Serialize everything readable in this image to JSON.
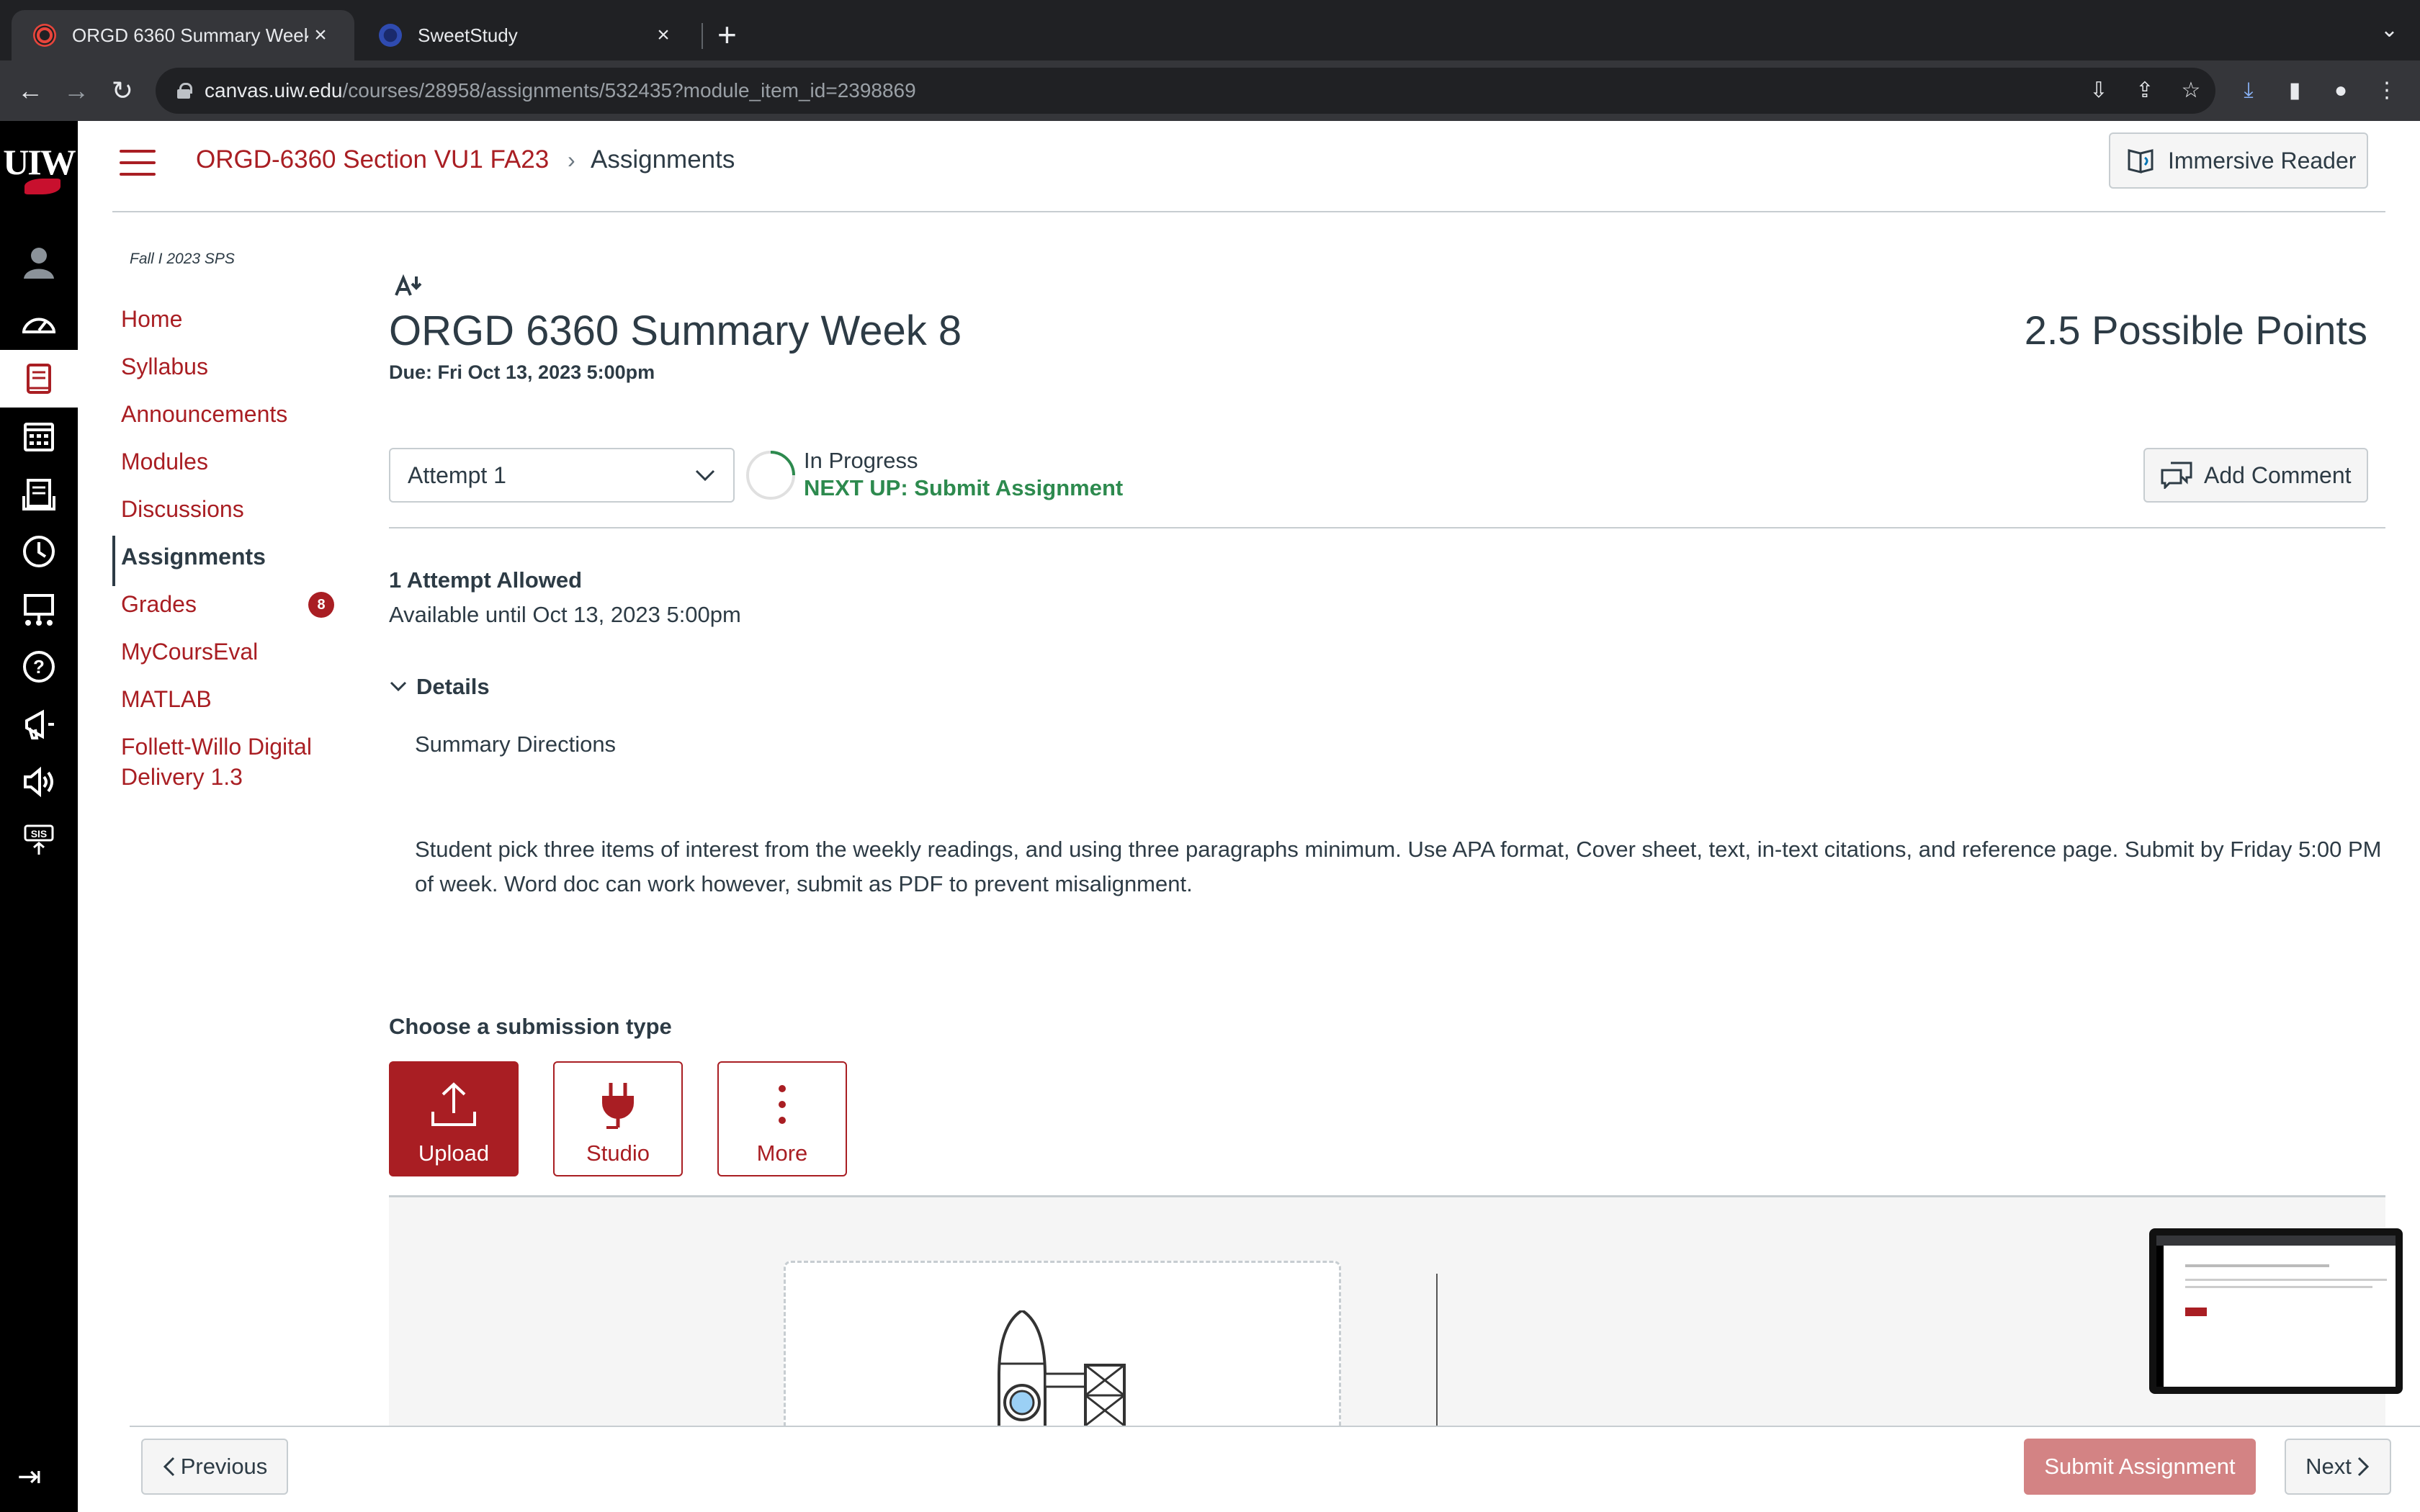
{
  "browser": {
    "tabs": [
      {
        "title": "ORGD 6360 Summary Week 8",
        "active": true
      },
      {
        "title": "SweetStudy",
        "active": false
      }
    ],
    "url_host": "canvas.uiw.edu",
    "url_path": "/courses/28958/assignments/532435?module_item_id=2398869"
  },
  "global_nav": {
    "logo": "UIW",
    "items": [
      "account-icon",
      "dashboard-icon",
      "courses-icon",
      "calendar-icon",
      "inbox-icon",
      "history-icon",
      "commons-icon",
      "help-icon",
      "announcements-icon",
      "accessibility-icon",
      "sis-icon"
    ],
    "sis_label": "SIS"
  },
  "header": {
    "course": "ORGD-6360 Section VU1 FA23",
    "separator": "›",
    "page": "Assignments",
    "immersive_reader": "Immersive Reader"
  },
  "course_nav": {
    "term": "Fall I 2023 SPS",
    "items": [
      {
        "label": "Home"
      },
      {
        "label": "Syllabus"
      },
      {
        "label": "Announcements"
      },
      {
        "label": "Modules"
      },
      {
        "label": "Discussions"
      },
      {
        "label": "Assignments",
        "active": true
      },
      {
        "label": "Grades",
        "badge": "8"
      },
      {
        "label": "MyCoursEval"
      },
      {
        "label": "MATLAB"
      },
      {
        "label": "Follett-Willo Digital Delivery 1.3"
      }
    ]
  },
  "assignment": {
    "title": "ORGD 6360 Summary Week 8",
    "due": "Due: Fri Oct 13, 2023 5:00pm",
    "points": "2.5 Possible Points",
    "attempt_selected": "Attempt 1",
    "status": "In Progress",
    "next_up": "NEXT UP: Submit Assignment",
    "add_comment": "Add Comment",
    "attempts_allowed": "1 Attempt Allowed",
    "available_until": "Available until Oct 13, 2023 5:00pm",
    "details_label": "Details",
    "description_heading": "Summary Directions",
    "description_body": "Student pick three items of interest from the weekly readings, and using three paragraphs minimum. Use APA format, Cover sheet, text, in-text citations, and reference page. Submit by Friday  5:00 PM of week. Word doc can work however, submit as PDF to prevent misalignment."
  },
  "submission": {
    "heading": "Choose a submission type",
    "types": [
      {
        "label": "Upload",
        "icon": "upload-icon",
        "selected": true
      },
      {
        "label": "Studio",
        "icon": "plug-icon",
        "selected": false
      },
      {
        "label": "More",
        "icon": "more-vertical-icon",
        "selected": false
      }
    ]
  },
  "footer": {
    "previous": "Previous",
    "submit": "Submit Assignment",
    "next": "Next"
  },
  "colors": {
    "brand_red": "#a91e23",
    "text": "#2d3b45",
    "success_green": "#2d8a4e",
    "submit_disabled": "#d38384",
    "nav_bg": "#000000"
  }
}
